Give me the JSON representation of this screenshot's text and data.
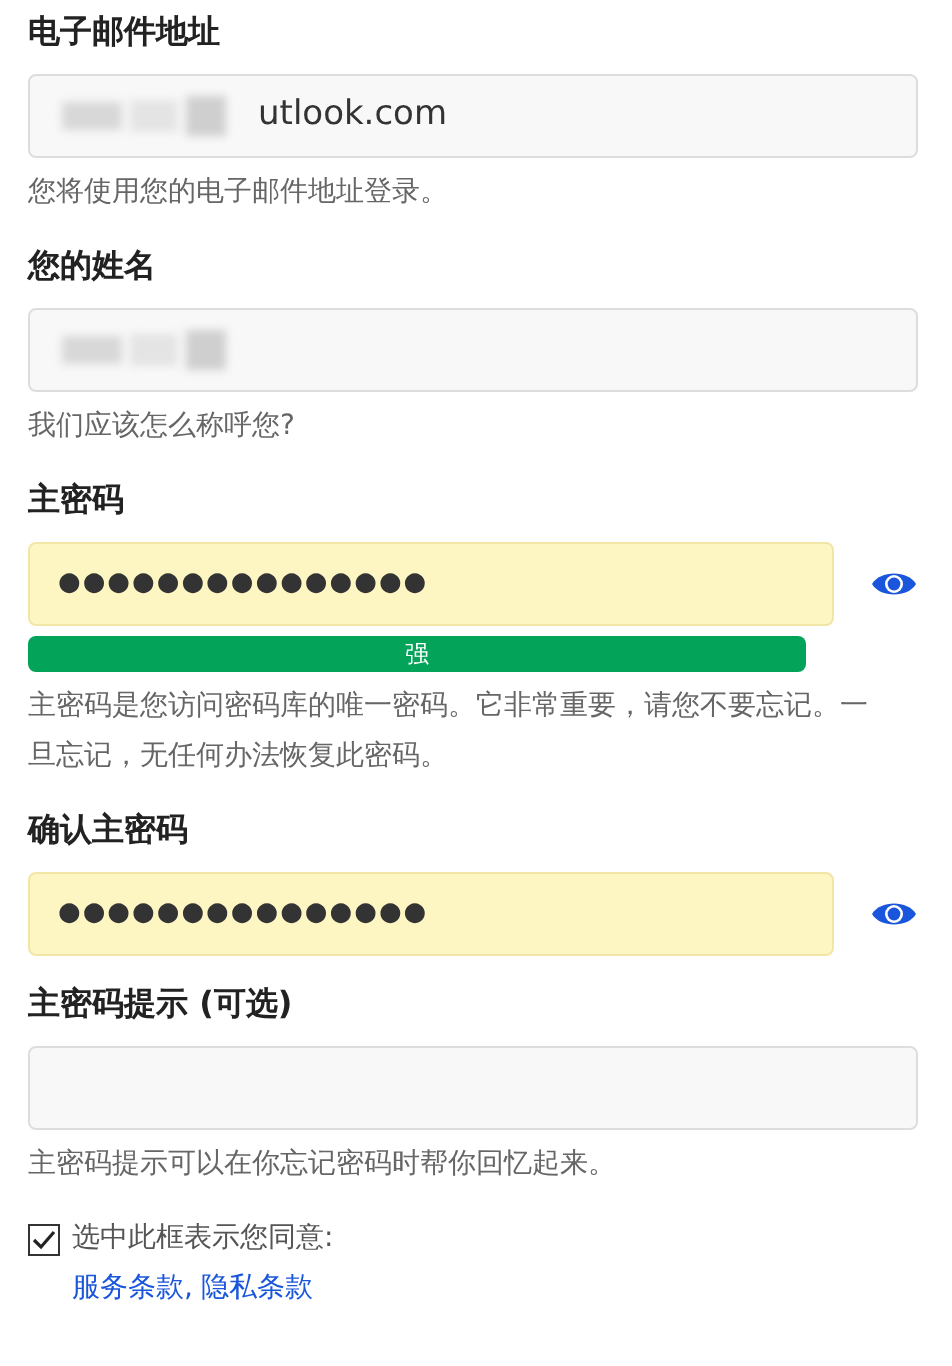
{
  "fields": [
    {
      "kind": "text",
      "label": "电子邮件地址",
      "value": "utlook.com",
      "redacted": true,
      "help": "您将使用您的电子邮件地址登录。"
    },
    {
      "kind": "text",
      "label": "您的姓名",
      "redacted": true,
      "help": "我们应该怎么称呼您?"
    },
    {
      "kind": "password",
      "label": "主密码",
      "value": "●●●●●●●●●●●●●●●",
      "strength": {
        "level": 1,
        "label": "强"
      },
      "help": "主密码是您访问密码库的唯一密码。它非常重要，请您不要忘记。一旦忘记，无任何办法恢复此密码。"
    },
    {
      "kind": "password",
      "label": "确认主密码",
      "value": "●●●●●●●●●●●●●●●"
    },
    {
      "kind": "text",
      "label": "主密码提示 (可选)",
      "help": "主密码提示可以在你忘记密码时帮你回忆起来。"
    }
  ],
  "agreement": {
    "checked": true,
    "text": "选中此框表示您同意:",
    "links": [
      "服务条款",
      "隐私条款"
    ],
    "separator": ","
  }
}
